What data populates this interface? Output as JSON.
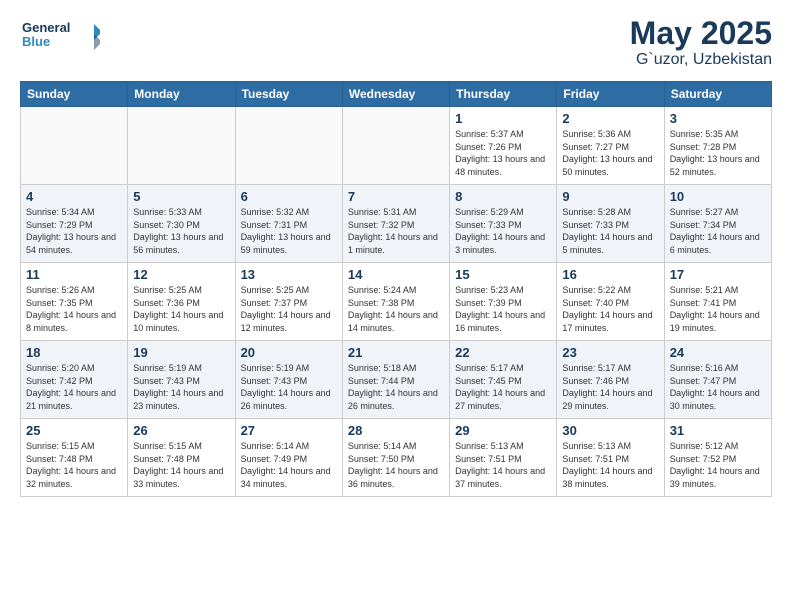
{
  "header": {
    "logo_general": "General",
    "logo_blue": "Blue",
    "title": "May 2025",
    "subtitle": "G`uzor, Uzbekistan"
  },
  "weekdays": [
    "Sunday",
    "Monday",
    "Tuesday",
    "Wednesday",
    "Thursday",
    "Friday",
    "Saturday"
  ],
  "weeks": [
    [
      {
        "day": "",
        "sunrise": "",
        "sunset": "",
        "daylight": ""
      },
      {
        "day": "",
        "sunrise": "",
        "sunset": "",
        "daylight": ""
      },
      {
        "day": "",
        "sunrise": "",
        "sunset": "",
        "daylight": ""
      },
      {
        "day": "",
        "sunrise": "",
        "sunset": "",
        "daylight": ""
      },
      {
        "day": "1",
        "sunrise": "Sunrise: 5:37 AM",
        "sunset": "Sunset: 7:26 PM",
        "daylight": "Daylight: 13 hours and 48 minutes."
      },
      {
        "day": "2",
        "sunrise": "Sunrise: 5:36 AM",
        "sunset": "Sunset: 7:27 PM",
        "daylight": "Daylight: 13 hours and 50 minutes."
      },
      {
        "day": "3",
        "sunrise": "Sunrise: 5:35 AM",
        "sunset": "Sunset: 7:28 PM",
        "daylight": "Daylight: 13 hours and 52 minutes."
      }
    ],
    [
      {
        "day": "4",
        "sunrise": "Sunrise: 5:34 AM",
        "sunset": "Sunset: 7:29 PM",
        "daylight": "Daylight: 13 hours and 54 minutes."
      },
      {
        "day": "5",
        "sunrise": "Sunrise: 5:33 AM",
        "sunset": "Sunset: 7:30 PM",
        "daylight": "Daylight: 13 hours and 56 minutes."
      },
      {
        "day": "6",
        "sunrise": "Sunrise: 5:32 AM",
        "sunset": "Sunset: 7:31 PM",
        "daylight": "Daylight: 13 hours and 59 minutes."
      },
      {
        "day": "7",
        "sunrise": "Sunrise: 5:31 AM",
        "sunset": "Sunset: 7:32 PM",
        "daylight": "Daylight: 14 hours and 1 minute."
      },
      {
        "day": "8",
        "sunrise": "Sunrise: 5:29 AM",
        "sunset": "Sunset: 7:33 PM",
        "daylight": "Daylight: 14 hours and 3 minutes."
      },
      {
        "day": "9",
        "sunrise": "Sunrise: 5:28 AM",
        "sunset": "Sunset: 7:33 PM",
        "daylight": "Daylight: 14 hours and 5 minutes."
      },
      {
        "day": "10",
        "sunrise": "Sunrise: 5:27 AM",
        "sunset": "Sunset: 7:34 PM",
        "daylight": "Daylight: 14 hours and 6 minutes."
      }
    ],
    [
      {
        "day": "11",
        "sunrise": "Sunrise: 5:26 AM",
        "sunset": "Sunset: 7:35 PM",
        "daylight": "Daylight: 14 hours and 8 minutes."
      },
      {
        "day": "12",
        "sunrise": "Sunrise: 5:25 AM",
        "sunset": "Sunset: 7:36 PM",
        "daylight": "Daylight: 14 hours and 10 minutes."
      },
      {
        "day": "13",
        "sunrise": "Sunrise: 5:25 AM",
        "sunset": "Sunset: 7:37 PM",
        "daylight": "Daylight: 14 hours and 12 minutes."
      },
      {
        "day": "14",
        "sunrise": "Sunrise: 5:24 AM",
        "sunset": "Sunset: 7:38 PM",
        "daylight": "Daylight: 14 hours and 14 minutes."
      },
      {
        "day": "15",
        "sunrise": "Sunrise: 5:23 AM",
        "sunset": "Sunset: 7:39 PM",
        "daylight": "Daylight: 14 hours and 16 minutes."
      },
      {
        "day": "16",
        "sunrise": "Sunrise: 5:22 AM",
        "sunset": "Sunset: 7:40 PM",
        "daylight": "Daylight: 14 hours and 17 minutes."
      },
      {
        "day": "17",
        "sunrise": "Sunrise: 5:21 AM",
        "sunset": "Sunset: 7:41 PM",
        "daylight": "Daylight: 14 hours and 19 minutes."
      }
    ],
    [
      {
        "day": "18",
        "sunrise": "Sunrise: 5:20 AM",
        "sunset": "Sunset: 7:42 PM",
        "daylight": "Daylight: 14 hours and 21 minutes."
      },
      {
        "day": "19",
        "sunrise": "Sunrise: 5:19 AM",
        "sunset": "Sunset: 7:43 PM",
        "daylight": "Daylight: 14 hours and 23 minutes."
      },
      {
        "day": "20",
        "sunrise": "Sunrise: 5:19 AM",
        "sunset": "Sunset: 7:43 PM",
        "daylight": "Daylight: 14 hours and 26 minutes."
      },
      {
        "day": "21",
        "sunrise": "Sunrise: 5:18 AM",
        "sunset": "Sunset: 7:44 PM",
        "daylight": "Daylight: 14 hours and 26 minutes."
      },
      {
        "day": "22",
        "sunrise": "Sunrise: 5:17 AM",
        "sunset": "Sunset: 7:45 PM",
        "daylight": "Daylight: 14 hours and 27 minutes."
      },
      {
        "day": "23",
        "sunrise": "Sunrise: 5:17 AM",
        "sunset": "Sunset: 7:46 PM",
        "daylight": "Daylight: 14 hours and 29 minutes."
      },
      {
        "day": "24",
        "sunrise": "Sunrise: 5:16 AM",
        "sunset": "Sunset: 7:47 PM",
        "daylight": "Daylight: 14 hours and 30 minutes."
      }
    ],
    [
      {
        "day": "25",
        "sunrise": "Sunrise: 5:15 AM",
        "sunset": "Sunset: 7:48 PM",
        "daylight": "Daylight: 14 hours and 32 minutes."
      },
      {
        "day": "26",
        "sunrise": "Sunrise: 5:15 AM",
        "sunset": "Sunset: 7:48 PM",
        "daylight": "Daylight: 14 hours and 33 minutes."
      },
      {
        "day": "27",
        "sunrise": "Sunrise: 5:14 AM",
        "sunset": "Sunset: 7:49 PM",
        "daylight": "Daylight: 14 hours and 34 minutes."
      },
      {
        "day": "28",
        "sunrise": "Sunrise: 5:14 AM",
        "sunset": "Sunset: 7:50 PM",
        "daylight": "Daylight: 14 hours and 36 minutes."
      },
      {
        "day": "29",
        "sunrise": "Sunrise: 5:13 AM",
        "sunset": "Sunset: 7:51 PM",
        "daylight": "Daylight: 14 hours and 37 minutes."
      },
      {
        "day": "30",
        "sunrise": "Sunrise: 5:13 AM",
        "sunset": "Sunset: 7:51 PM",
        "daylight": "Daylight: 14 hours and 38 minutes."
      },
      {
        "day": "31",
        "sunrise": "Sunrise: 5:12 AM",
        "sunset": "Sunset: 7:52 PM",
        "daylight": "Daylight: 14 hours and 39 minutes."
      }
    ]
  ]
}
